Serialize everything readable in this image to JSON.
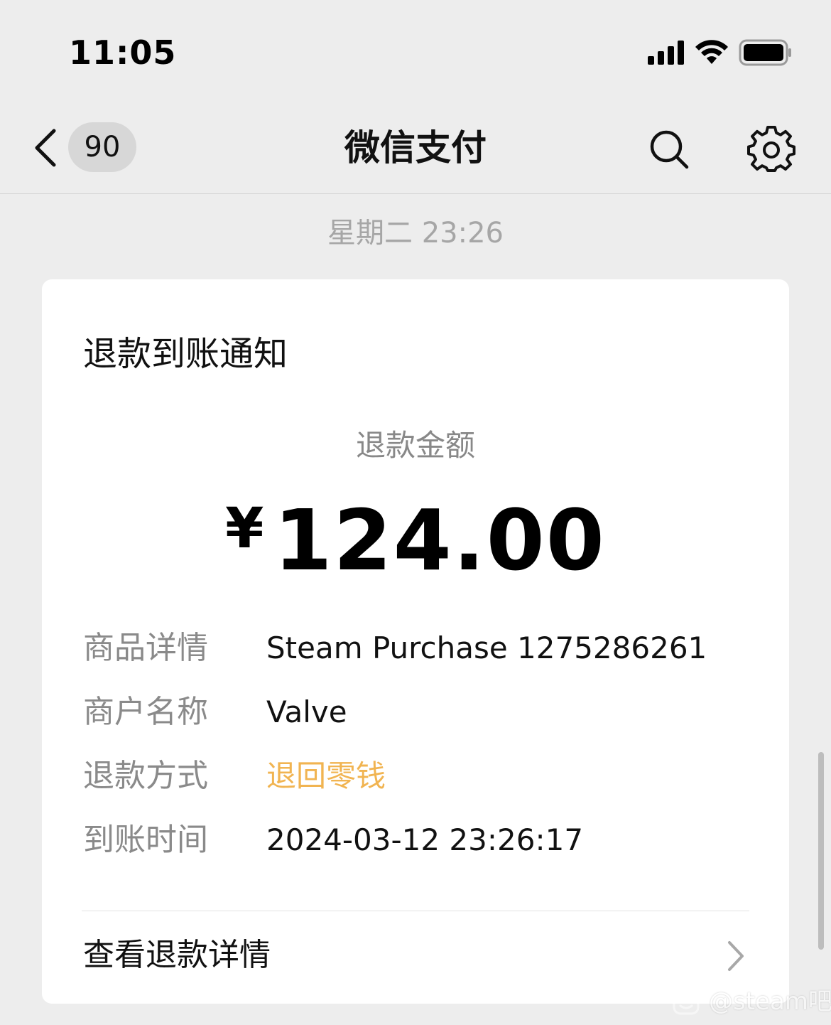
{
  "status_bar": {
    "time": "11:05",
    "icons": [
      "cellular-signal-icon",
      "wifi-icon",
      "battery-icon"
    ]
  },
  "nav": {
    "back_icon": "chevron-left-icon",
    "unread_count": "90",
    "title": "微信支付",
    "search_icon": "search-icon",
    "settings_icon": "gear-icon"
  },
  "message": {
    "timestamp": "星期二 23:26"
  },
  "card": {
    "title": "退款到账通知",
    "amount_label": "退款金额",
    "currency": "¥",
    "amount": "124.00",
    "details": [
      {
        "label": "商品详情",
        "value": "Steam Purchase 1275286261"
      },
      {
        "label": "商户名称",
        "value": "Valve"
      },
      {
        "label": "退款方式",
        "value": "退回零钱"
      },
      {
        "label": "到账时间",
        "value": "2024-03-12 23:26:17"
      }
    ],
    "footer_label": "查看退款详情",
    "footer_icon": "chevron-right-icon"
  },
  "watermark": {
    "text": "@steam吧"
  },
  "colors": {
    "page_background": "#ededed",
    "card_background": "#ffffff",
    "refund_method_accent": "#f1b451",
    "label_gray": "#8a8a8a",
    "timestamp_gray": "#a6a6a6"
  }
}
